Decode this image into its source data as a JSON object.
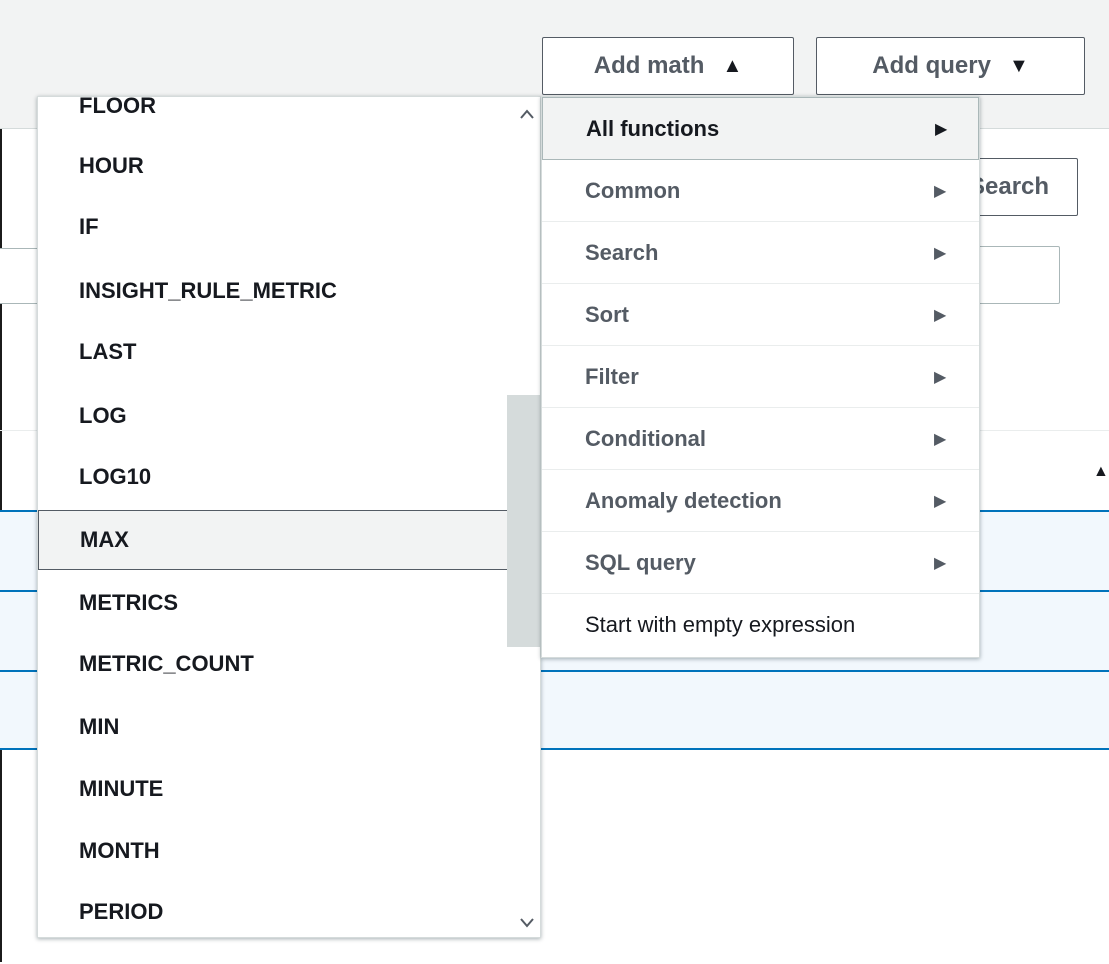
{
  "toolbar": {
    "add_math_label": "Add math",
    "add_math_caret": "▲",
    "add_query_label": "Add query",
    "add_query_caret": "▼",
    "search_button_label": "Search"
  },
  "function_list": {
    "items": [
      "FLOOR",
      "HOUR",
      "IF",
      "INSIGHT_RULE_METRIC",
      "LAST",
      "LOG",
      "LOG10",
      "MAX",
      "METRICS",
      "METRIC_COUNT",
      "MIN",
      "MINUTE",
      "MONTH",
      "PERIOD"
    ],
    "highlighted": "MAX"
  },
  "math_menu": {
    "items": [
      {
        "label": "All functions",
        "arrow": "▶"
      },
      {
        "label": "Common",
        "arrow": "▶"
      },
      {
        "label": "Search",
        "arrow": "▶"
      },
      {
        "label": "Sort",
        "arrow": "▶"
      },
      {
        "label": "Filter",
        "arrow": "▶"
      },
      {
        "label": "Conditional",
        "arrow": "▶"
      },
      {
        "label": "Anomaly detection",
        "arrow": "▶"
      },
      {
        "label": "SQL query",
        "arrow": "▶"
      },
      {
        "label": "Start with empty expression",
        "arrow": ""
      }
    ],
    "active": "All functions"
  },
  "icons": {
    "scroll_up": "chevron-up-icon",
    "scroll_down": "chevron-down-icon",
    "submenu": "caret-right-icon",
    "sort": "sort-ascending-icon"
  }
}
